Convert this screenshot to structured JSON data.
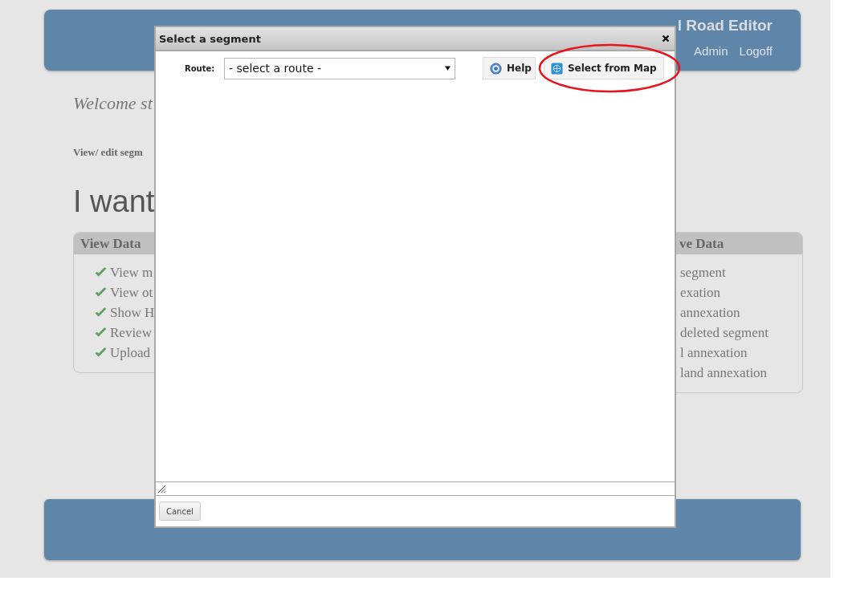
{
  "header": {
    "title": "l Road Editor",
    "nav": [
      "Admin",
      "Logoff"
    ]
  },
  "welcome": "Welcome st",
  "subheading": "View/ edit segm",
  "heading": "I want",
  "panels": [
    {
      "title": "View Data",
      "kind": "checklist",
      "items": [
        "View m",
        "View ot",
        "Show H",
        "Review",
        "Upload"
      ]
    },
    {
      "title": "ve Data",
      "kind": "plain",
      "items": [
        "segment",
        "exation",
        "annexation",
        "deleted segment",
        "l annexation",
        "land annexation"
      ]
    }
  ],
  "dialog": {
    "title": "Select a segment",
    "route_label": "Route:",
    "route_select": "- select a route -",
    "buttons": [
      {
        "label": "Help",
        "kind": "help"
      },
      {
        "label": "Select from Map",
        "kind": "map"
      }
    ],
    "cancel": "Cancel"
  }
}
